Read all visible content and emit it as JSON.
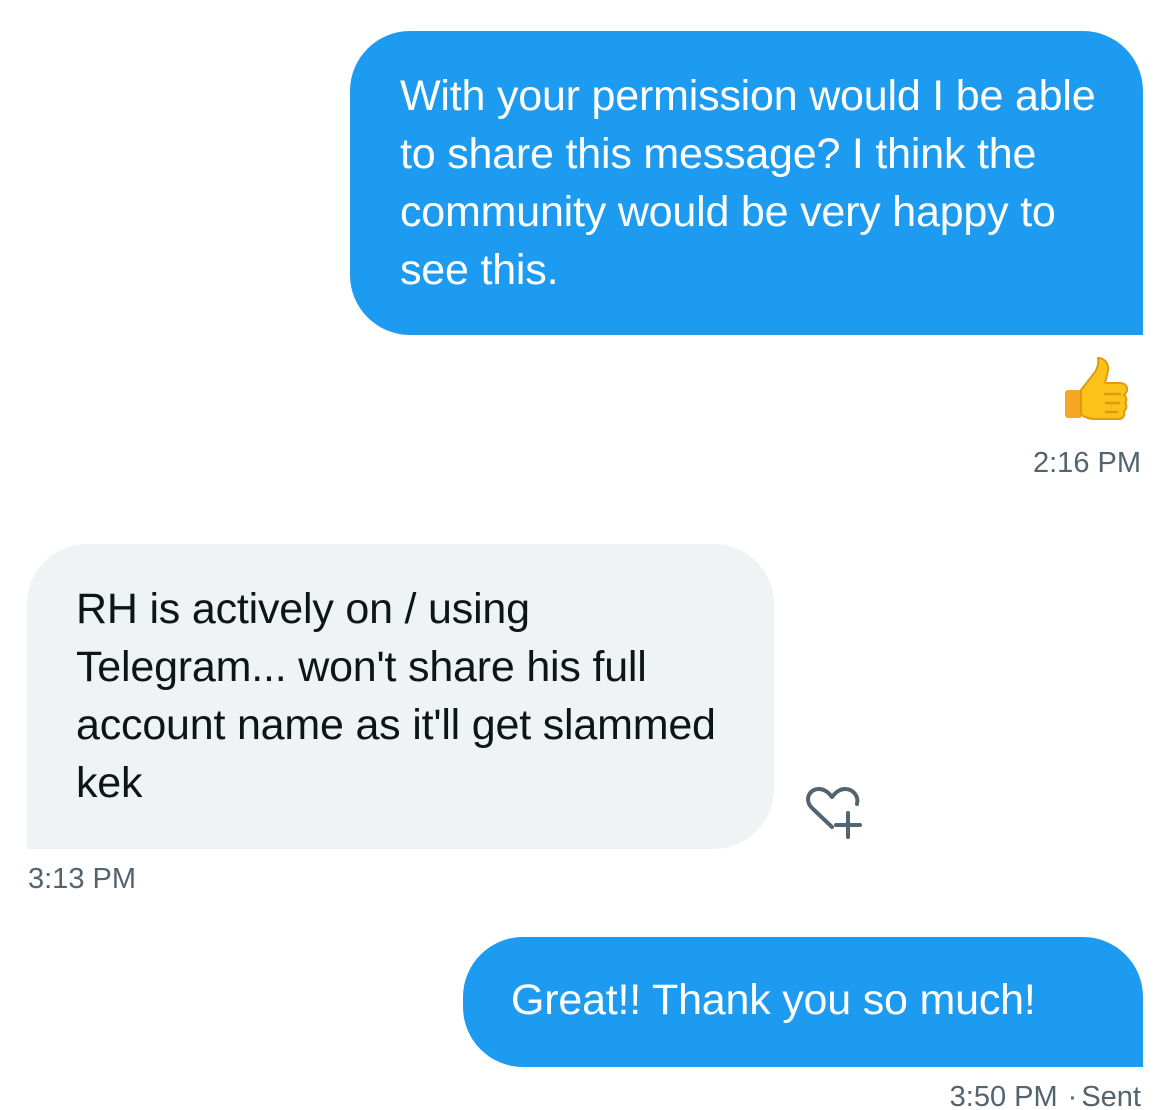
{
  "messages": [
    {
      "direction": "outgoing",
      "text": "With your permission would I be able to share this message? I think the community would be very happy to see this.",
      "reaction": "thumbs-up",
      "time": "2:16 PM"
    },
    {
      "direction": "incoming",
      "text": "RH is actively on / using Telegram... won't share his full account name as it'll get slammed kek",
      "time": "3:13 PM"
    },
    {
      "direction": "outgoing",
      "text": "Great!! Thank you so much!",
      "time": "3:50 PM",
      "separator": "·",
      "status": "Sent"
    }
  ],
  "icons": {
    "reaction": "thumbs-up-emoji",
    "add_reaction": "heart-plus-icon"
  },
  "colors": {
    "outgoing_bubble": "#1d9bf0",
    "incoming_bubble": "#eff3f4",
    "timestamp": "#536471",
    "background": "#ffffff"
  }
}
